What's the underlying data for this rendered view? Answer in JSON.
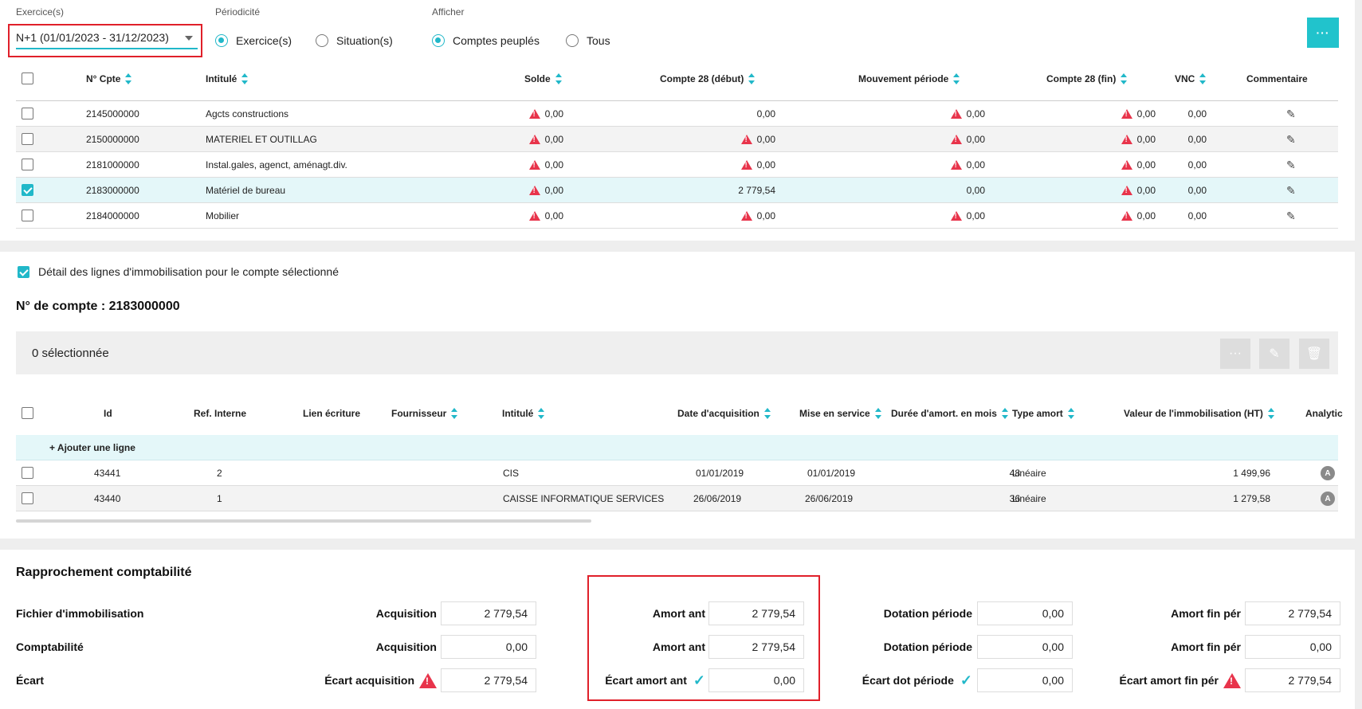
{
  "filters": {
    "exercice_label": "Exercice(s)",
    "exercice_value": "N+1 (01/01/2023 - 31/12/2023)",
    "periodicite_label": "Périodicité",
    "periodicite_options": [
      "Exercice(s)",
      "Situation(s)"
    ],
    "afficher_label": "Afficher",
    "afficher_options": [
      "Comptes peuplés",
      "Tous"
    ],
    "more_label": "···"
  },
  "accounts_table": {
    "headers": [
      "N° Cpte",
      "Intitulé",
      "Solde",
      "Compte 28 (début)",
      "Mouvement période",
      "Compte 28 (fin)",
      "VNC",
      "Commentaire"
    ],
    "rows": [
      {
        "num": "2145000000",
        "label": "Agcts constructions",
        "solde": "0,00",
        "c28d": "0,00",
        "mvt": "0,00",
        "c28f": "0,00",
        "vnc": "0,00"
      },
      {
        "num": "2150000000",
        "label": "MATERIEL ET OUTILLAG",
        "solde": "0,00",
        "c28d": "0,00",
        "mvt": "0,00",
        "c28f": "0,00",
        "vnc": "0,00"
      },
      {
        "num": "2181000000",
        "label": "Instal.gales, agenct, aménagt.div.",
        "solde": "0,00",
        "c28d": "0,00",
        "mvt": "0,00",
        "c28f": "0,00",
        "vnc": "0,00"
      },
      {
        "num": "2183000000",
        "label": "Matériel de bureau",
        "solde": "0,00",
        "c28d": "2 779,54",
        "mvt": "0,00",
        "c28f": "0,00",
        "vnc": "0,00"
      },
      {
        "num": "2184000000",
        "label": "Mobilier",
        "solde": "0,00",
        "c28d": "0,00",
        "mvt": "0,00",
        "c28f": "0,00",
        "vnc": "0,00"
      }
    ]
  },
  "detail": {
    "checkbox_label": "Détail des lignes d'immobilisation pour le compte sélectionné",
    "account_title": "N° de compte : 2183000000",
    "selected_count": "0 sélectionnée",
    "toolbar_more": "···",
    "headers": [
      "Id",
      "Ref. Interne",
      "Lien écriture",
      "Fournisseur",
      "Intitulé",
      "Date d'acquisition",
      "Mise en service",
      "Durée d'amort. en mois",
      "Type amort",
      "Valeur de l'immobilisation (HT)",
      "Analytic"
    ],
    "add_line": "+ Ajouter une ligne",
    "rows": [
      {
        "id": "43441",
        "ref": "2",
        "label": "CIS",
        "date_acq": "01/01/2019",
        "mise": "01/01/2019",
        "duree": "48",
        "type": "Linéaire",
        "valeur": "1 499,96",
        "badge": "A"
      },
      {
        "id": "43440",
        "ref": "1",
        "label": "CAISSE INFORMATIQUE SERVICES",
        "date_acq": "26/06/2019",
        "mise": "26/06/2019",
        "duree": "36",
        "type": "Linéaire",
        "valeur": "1 279,58",
        "badge": "A"
      }
    ]
  },
  "reconciliation": {
    "title": "Rapprochement comptabilité",
    "row_labels": [
      "Fichier d'immobilisation",
      "Comptabilité",
      "Écart"
    ],
    "col1": {
      "labels": [
        "Acquisition",
        "Acquisition",
        "Écart acquisition"
      ],
      "values": [
        "2 779,54",
        "0,00",
        "2 779,54"
      ]
    },
    "col2": {
      "labels": [
        "Amort ant",
        "Amort ant",
        "Écart amort ant"
      ],
      "values": [
        "2 779,54",
        "2 779,54",
        "0,00"
      ]
    },
    "col3": {
      "labels": [
        "Dotation période",
        "Dotation période",
        "Écart dot période"
      ],
      "values": [
        "0,00",
        "0,00",
        "0,00"
      ]
    },
    "col4": {
      "labels": [
        "Amort fin pér",
        "Amort fin pér",
        "Écart amort fin pér"
      ],
      "values": [
        "2 779,54",
        "0,00",
        "2 779,54"
      ]
    }
  }
}
